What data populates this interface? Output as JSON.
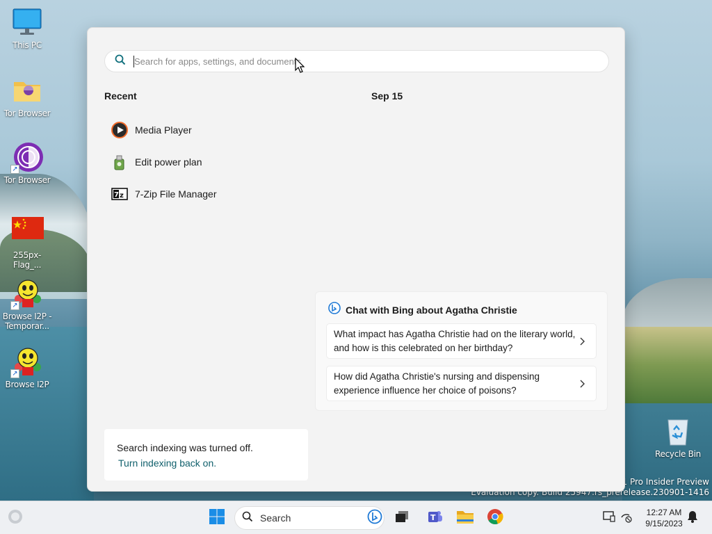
{
  "desktop": {
    "icons": [
      {
        "label": "This PC"
      },
      {
        "label": "Tor Browser"
      },
      {
        "label": "Tor Browser"
      },
      {
        "label": "255px-Flag_..."
      },
      {
        "label": "Browse I2P - Temporar..."
      },
      {
        "label": "Browse I2P"
      }
    ],
    "recycle_bin": "Recycle Bin",
    "watermark_line1": "11 Pro Insider Preview",
    "watermark_line2": "Evaluation copy. Build 25947.rs_prerelease.230901-1416"
  },
  "search_flyout": {
    "search_placeholder": "Search for apps, settings, and documents",
    "recent_title": "Recent",
    "date_title": "Sep 15",
    "recent_items": [
      {
        "label": "Media Player",
        "icon": "media-player-icon"
      },
      {
        "label": "Edit power plan",
        "icon": "power-plan-icon"
      },
      {
        "label": "7-Zip File Manager",
        "icon": "7zip-icon"
      }
    ],
    "bing": {
      "title": "Chat with Bing about Agatha Christie",
      "questions": [
        "What impact has Agatha Christie had on the literary world, and how is this celebrated on her birthday?",
        "How did Agatha Christie's nursing and dispensing experience influence her choice of poisons?"
      ]
    },
    "indexing": {
      "message": "Search indexing was turned off.",
      "link": "Turn indexing back on."
    }
  },
  "taskbar": {
    "search_label": "Search",
    "time": "12:27 AM",
    "date": "9/15/2023"
  },
  "colors": {
    "accent": "#0078d4",
    "link": "#0f5f6b"
  }
}
